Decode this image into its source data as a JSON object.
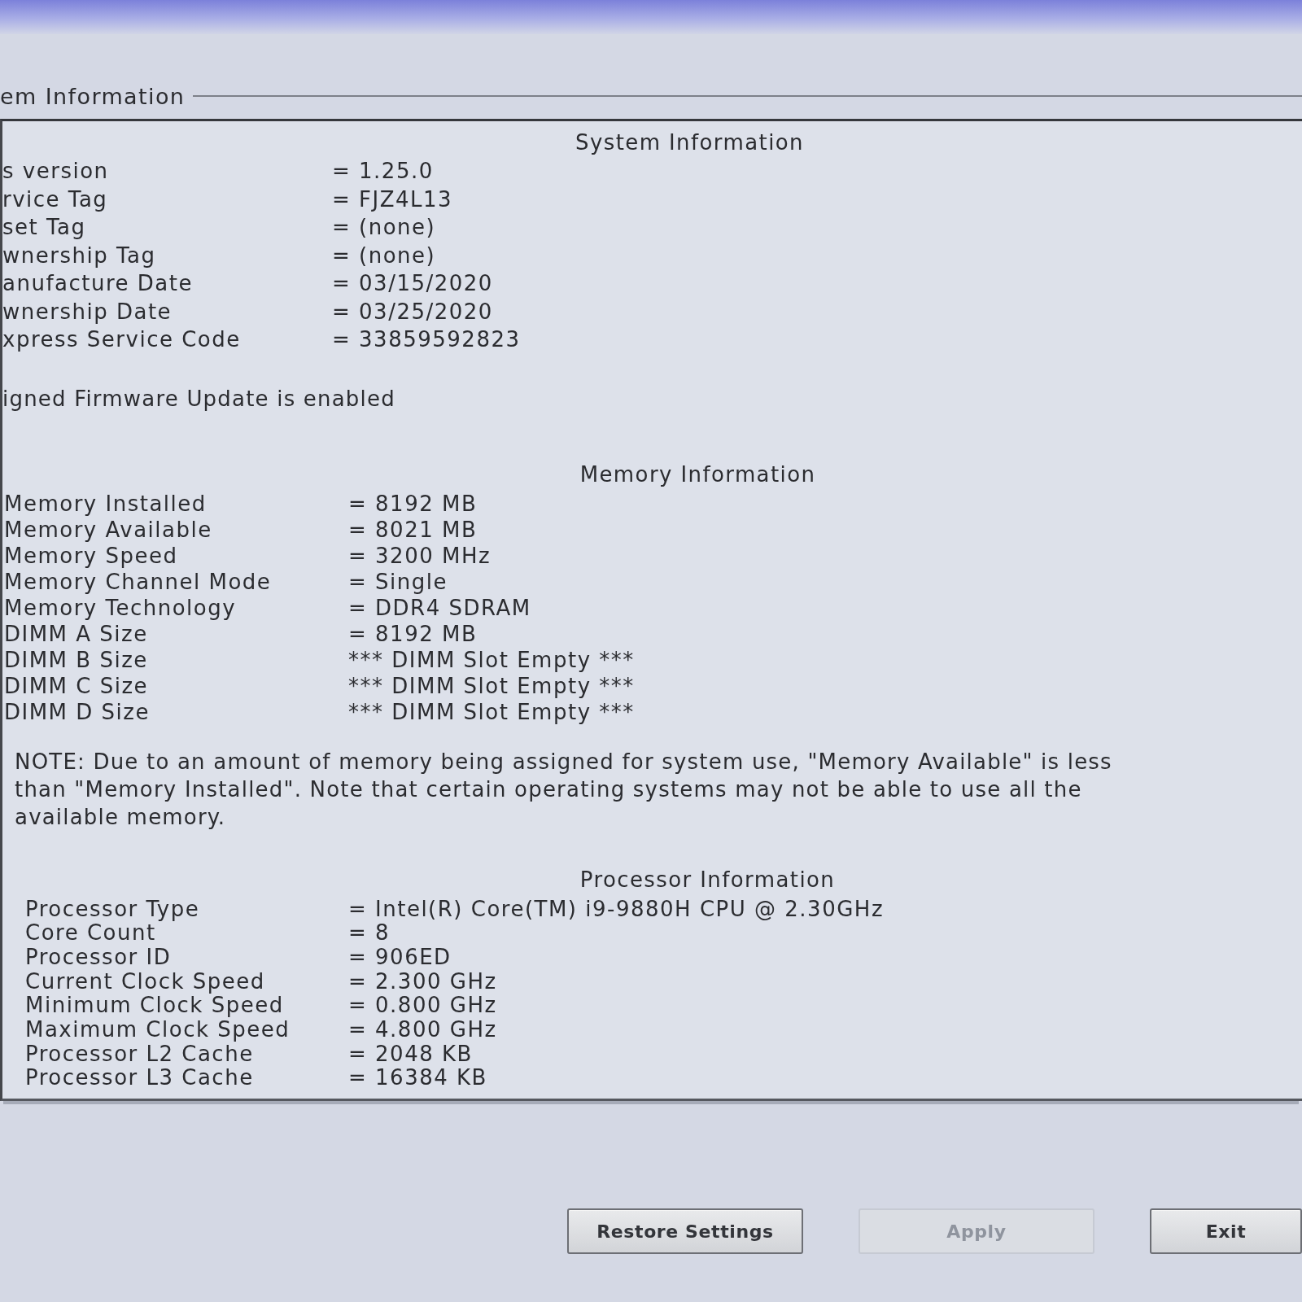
{
  "group_title": "em Information",
  "sections": [
    {
      "heading": "System Information",
      "rows": [
        {
          "label": "s version",
          "value": "= 1.25.0"
        },
        {
          "label": "rvice Tag",
          "value": "= FJZ4L13"
        },
        {
          "label": "set Tag",
          "value": "= (none)"
        },
        {
          "label": "wnership Tag",
          "value": "= (none)"
        },
        {
          "label": "anufacture Date",
          "value": "= 03/15/2020"
        },
        {
          "label": "wnership Date",
          "value": "= 03/25/2020"
        },
        {
          "label": "xpress Service Code",
          "value": "= 33859592823"
        }
      ],
      "note": "igned Firmware Update is enabled"
    },
    {
      "heading": "Memory Information",
      "rows": [
        {
          "label": "Memory Installed",
          "value": "= 8192 MB"
        },
        {
          "label": "Memory Available",
          "value": "= 8021 MB"
        },
        {
          "label": "Memory Speed",
          "value": "= 3200 MHz"
        },
        {
          "label": "Memory Channel Mode",
          "value": "= Single"
        },
        {
          "label": "Memory Technology",
          "value": "= DDR4 SDRAM"
        },
        {
          "label": "DIMM A Size",
          "value": "= 8192 MB"
        },
        {
          "label": "DIMM B Size",
          "value": "*** DIMM Slot Empty ***"
        },
        {
          "label": "DIMM C Size",
          "value": "*** DIMM Slot Empty ***"
        },
        {
          "label": "DIMM D Size",
          "value": "*** DIMM Slot Empty ***"
        }
      ],
      "note": "NOTE: Due to an amount of memory being assigned for system use, \"Memory Available\" is less than \"Memory Installed\". Note that certain operating systems may not be able to use all the available memory."
    },
    {
      "heading": "Processor Information",
      "rows": [
        {
          "label": "Processor Type",
          "value": "= Intel(R) Core(TM) i9-9880H CPU @ 2.30GHz"
        },
        {
          "label": "Core Count",
          "value": "= 8"
        },
        {
          "label": "Processor ID",
          "value": "= 906ED"
        },
        {
          "label": "Current Clock Speed",
          "value": "= 2.300 GHz"
        },
        {
          "label": "Minimum Clock Speed",
          "value": "= 0.800 GHz"
        },
        {
          "label": "Maximum Clock Speed",
          "value": "= 4.800 GHz"
        },
        {
          "label": "Processor L2 Cache",
          "value": "= 2048 KB"
        },
        {
          "label": "Processor L3 Cache",
          "value": "= 16384 KB"
        }
      ]
    }
  ],
  "buttons": [
    {
      "label": "Restore Settings",
      "disabled": false
    },
    {
      "label": "Apply",
      "disabled": true
    },
    {
      "label": "Exit",
      "disabled": false
    }
  ]
}
